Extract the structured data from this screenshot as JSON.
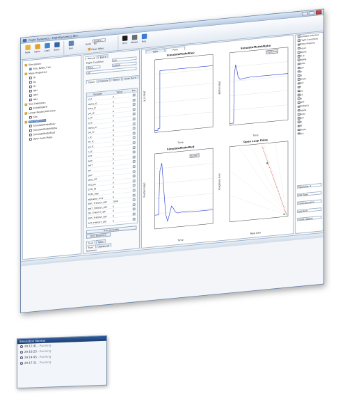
{
  "window": {
    "title": "Flight Dynamics - FlightDynamics.fdm"
  },
  "ribbon": {
    "buttons": [
      {
        "label": "New",
        "icon": "new-file-icon",
        "color": "#e8b23a"
      },
      {
        "label": "Open",
        "icon": "open-folder-icon",
        "color": "#e4a02c"
      },
      {
        "label": "Load",
        "icon": "load-icon",
        "color": "#3f86c9"
      },
      {
        "label": "Save",
        "icon": "save-icon",
        "color": "#3465a4"
      },
      {
        "label": "Run",
        "icon": "run-icon",
        "color": "#5c83b8"
      },
      {
        "label": "Trim",
        "icon": "trim-icon",
        "color": "#1a1a1a"
      },
      {
        "label": "Model",
        "icon": "model-icon",
        "color": "#666e78"
      },
      {
        "label": "Rep",
        "icon": "report-icon",
        "color": "#3a7bd5"
      }
    ],
    "units_label": "Units",
    "units_value": "English - BS",
    "clear_table": "Clear Table"
  },
  "tree": [
    {
      "label": "Simulation",
      "level": 0,
      "icon": "folder-icon"
    },
    {
      "label": "Sim_B206_T.sls",
      "level": 1,
      "icon": "file-icon"
    },
    {
      "label": "Mass Properties",
      "level": 0,
      "icon": "folder-icon"
    },
    {
      "label": "IX",
      "level": 1,
      "icon": "checkbox"
    },
    {
      "label": "AL",
      "level": 1,
      "icon": "checkbox"
    },
    {
      "label": "IH",
      "level": 1,
      "icon": "checkbox"
    },
    {
      "label": "IHH",
      "level": 1,
      "icon": "checkbox"
    },
    {
      "label": "IHM",
      "level": 1,
      "icon": "checkbox"
    },
    {
      "label": "IHH",
      "level": 1,
      "icon": "checkbox"
    },
    {
      "label": "Trim Definition",
      "level": 0,
      "icon": "folder-icon"
    },
    {
      "label": "FCOMTRATH",
      "level": 1,
      "icon": "checkbox"
    },
    {
      "label": "Linear Model Definition",
      "level": 0,
      "icon": "folder-icon"
    },
    {
      "label": "Sim",
      "level": 1,
      "icon": "checkbox"
    },
    {
      "label": "Plot Definition",
      "level": 0,
      "icon": "folder-icon",
      "selected": true
    },
    {
      "label": "SimulateModelElev",
      "level": 1,
      "icon": "checkbox"
    },
    {
      "label": "SimulateModelAlpha",
      "level": 1,
      "icon": "checkbox"
    },
    {
      "label": "SimulateModelRud",
      "level": 1,
      "icon": "checkbox"
    },
    {
      "label": "Open Loop Poles",
      "level": 1,
      "icon": "checkbox"
    }
  ],
  "mid": {
    "tabs": [
      "Manual",
      "Batch"
    ],
    "flight_condition_label": "Flight Condition",
    "fc_value": "0.6",
    "mach_label": "Mach",
    "alt_value": "20000",
    "all_label": "All",
    "sub_tabs": [
      "Inputs",
      "Outputs",
      "States",
      "State Deriv"
    ],
    "col_variable": "Variable",
    "col_value": "Value",
    "col_plot": "Plo",
    "rows": [
      {
        "v": "V_0",
        "val": "0"
      },
      {
        "v": "alpha_IC",
        "val": "0"
      },
      {
        "v": "beta_IC",
        "val": "0"
      },
      {
        "v": "phi_IC",
        "val": "0"
      },
      {
        "v": "p_IC",
        "val": "0"
      },
      {
        "v": "q_IC",
        "val": "0"
      },
      {
        "v": "theta_IC",
        "val": "0"
      },
      {
        "v": "psi_IC",
        "val": "0"
      },
      {
        "v": "r_IC",
        "val": "0"
      },
      {
        "v": "xe_IC",
        "val": "0"
      },
      {
        "v": "ye_IC",
        "val": "0"
      },
      {
        "v": "h_IC",
        "val": "0"
      },
      {
        "v": "AFT",
        "val": "0"
      },
      {
        "v": "BHT",
        "val": "0"
      },
      {
        "v": "DHT",
        "val": "0"
      },
      {
        "v": "DV",
        "val": "0"
      },
      {
        "v": "DVT",
        "val": "0"
      },
      {
        "v": "DCG_FIT",
        "val": "0"
      },
      {
        "v": "YCG_IN",
        "val": "0"
      },
      {
        "v": "ZCG_IN",
        "val": "0"
      },
      {
        "v": "FUEL_RES",
        "val": "0"
      },
      {
        "v": "alphadot_cmd",
        "val": "0"
      },
      {
        "v": "BHT_THRUST_LBF",
        "val": "1000"
      },
      {
        "v": "DHT_THRUST_LBF",
        "val": "0"
      },
      {
        "v": "DV_THRUST_LBF",
        "val": "0"
      },
      {
        "v": "DVT_THRUST_LBF",
        "val": "0"
      },
      {
        "v": "AFT_THRUST_LBF",
        "val": "0"
      }
    ],
    "trim_btn_a": "Trim Variables",
    "trim_btn_b": "Trim Equations",
    "bottom_tabs": [
      "Tools",
      "Table"
    ],
    "mode_tabs": [
      "Basic",
      "Advanced"
    ],
    "set_items": "Set Items"
  },
  "plots": {
    "tabs": [
      "Table",
      "Plots"
    ],
    "elev": {
      "title": "SimulateModelElev",
      "xlabel": "Time",
      "ylabel": "q_s (deg)"
    },
    "alpha": {
      "title": "SimulateModelAlpha",
      "xlabel": "Time",
      "ylabel": "alpha (deg)",
      "legend": "SigAlphaA"
    },
    "rud": {
      "title": "SimulateModelRud",
      "xlabel": "Time",
      "ylabel": "Rudder (deg)",
      "legend": "Rudder"
    },
    "poles": {
      "title": "Open Loop Poles",
      "xlabel": "Real Axis",
      "ylabel": "Imaginary Axis"
    }
  },
  "right": {
    "items": [
      "Variable Selection",
      "Flight Conditions",
      "Mass Property",
      "Input",
      "Alpha",
      "V_0",
      "alpha",
      "beta",
      "phi",
      "p",
      "q",
      "theta",
      "psi",
      "r",
      "xe",
      "ye",
      "h",
      "AFT",
      "Outputs",
      "alpha",
      "beta",
      "phi",
      "p",
      "q",
      "theta",
      "psi"
    ],
    "footer": [
      "Figure No. 1",
      "Plot Type",
      "Y-Axis Location",
      "Add Axis",
      "Show Legend"
    ]
  },
  "console": {
    "title": "Simulation Monitor",
    "lines": [
      {
        "time": "29:17:41",
        "status": "Running"
      },
      {
        "time": "29:16:23",
        "status": "Running"
      },
      {
        "time": "29:14:45",
        "status": "Running"
      },
      {
        "time": "29:17:11",
        "status": "Running"
      }
    ]
  }
}
